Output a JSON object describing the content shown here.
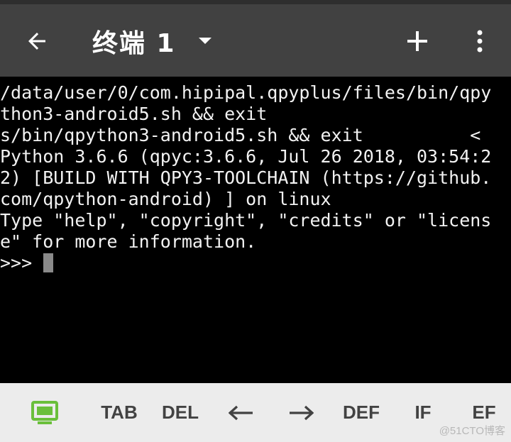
{
  "app_bar": {
    "title": "终端 1",
    "back_icon": "arrow-left-icon",
    "dropdown_icon": "caret-down-icon",
    "add_icon": "plus-icon",
    "more_icon": "vertical-dots-icon",
    "background": "#414141"
  },
  "terminal": {
    "lines": [
      "/data/user/0/com.hipipal.qpyplus/files/bin/qpy",
      "thon3-android5.sh && exit",
      "s/bin/qpython3-android5.sh && exit          <",
      "Python 3.6.6 (qpyc:3.6.6, Jul 26 2018, 03:54:2",
      "2) [BUILD WITH QPY3-TOOLCHAIN (https://github.",
      "com/qpython-android) ] on linux",
      "Type \"help\", \"copyright\", \"credits\" or \"licens",
      "e\" for more information.",
      ">>> "
    ],
    "background": "#000000",
    "text_color": "#f2f2f2"
  },
  "extra_keys": {
    "keyboard_icon": "keyboard-monitor-icon",
    "accent": "#6abf3b",
    "keys": [
      "TAB",
      "DEL",
      "←",
      "→",
      "DEF",
      "IF",
      "EF"
    ]
  },
  "watermark": "@51CTO博客"
}
